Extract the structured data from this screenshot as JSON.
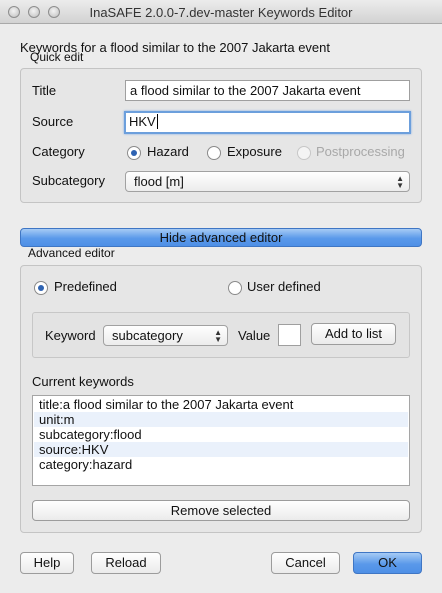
{
  "window": {
    "title": "InaSAFE 2.0.0-7.dev-master Keywords Editor"
  },
  "header_text": "Keywords for a flood similar to the 2007 Jakarta event",
  "quick_edit": {
    "legend": "Quick edit",
    "title_label": "Title",
    "title_value": "a flood similar to the 2007 Jakarta event",
    "source_label": "Source",
    "source_value": "HKV",
    "category_label": "Category",
    "category_options": [
      {
        "label": "Hazard",
        "selected": true,
        "enabled": true
      },
      {
        "label": "Exposure",
        "selected": false,
        "enabled": true
      },
      {
        "label": "Postprocessing",
        "selected": false,
        "enabled": false
      }
    ],
    "subcategory_label": "Subcategory",
    "subcategory_value": "flood [m]"
  },
  "toggle_button_label": "Hide advanced editor",
  "advanced_editor": {
    "legend": "Advanced editor",
    "predefined_label": "Predefined",
    "predefined_selected": true,
    "user_defined_label": "User defined",
    "user_defined_selected": false,
    "keyword_label": "Keyword",
    "keyword_value": "subcategory",
    "value_label": "Value",
    "value_value": "",
    "add_button_label": "Add to list",
    "current_keywords_label": "Current keywords",
    "keywords": [
      "title:a flood similar to the 2007 Jakarta event",
      "unit:m",
      "subcategory:flood",
      "source:HKV",
      "category:hazard"
    ],
    "remove_button_label": "Remove selected"
  },
  "footer": {
    "help_label": "Help",
    "reload_label": "Reload",
    "cancel_label": "Cancel",
    "ok_label": "OK"
  },
  "colors": {
    "accent_blue": "#5a99ea",
    "focus_ring": "#6c9fdc"
  }
}
